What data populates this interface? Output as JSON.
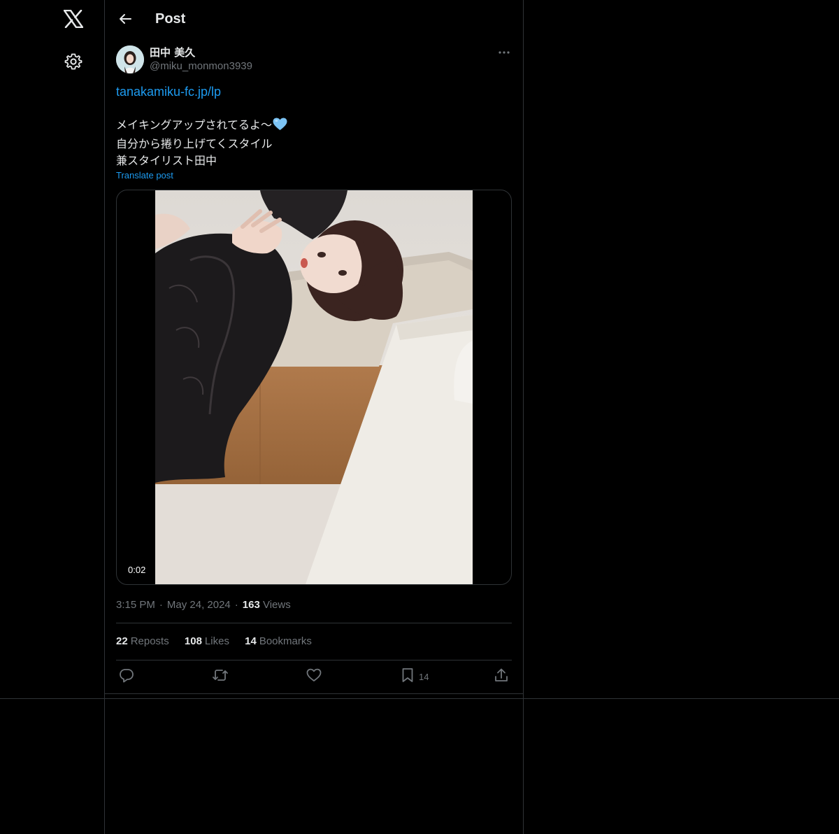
{
  "header": {
    "title": "Post"
  },
  "author": {
    "name": "田中 美久",
    "handle": "@miku_monmon3939"
  },
  "post": {
    "link": "tanakamiku-fc.jp/lp",
    "lines": [
      "メイキングアップされてるよ〜",
      "自分から捲り上げてくスタイル",
      "兼スタイリスト田中"
    ],
    "translate_label": "Translate post"
  },
  "media": {
    "duration": "0:02"
  },
  "meta": {
    "time": "3:15 PM",
    "date": "May 24, 2024",
    "views_count": "163",
    "views_label": "Views"
  },
  "stats": {
    "reposts_count": "22",
    "reposts_label": "Reposts",
    "likes_count": "108",
    "likes_label": "Likes",
    "bookmarks_count": "14",
    "bookmarks_label": "Bookmarks"
  },
  "actions": {
    "bookmark_count": "14"
  },
  "colors": {
    "accent": "#1d9bf0",
    "muted": "#71767b",
    "border": "#2f3336",
    "background": "#000000",
    "text": "#e7e9ea"
  },
  "icons": [
    "x-logo-icon",
    "gear-icon",
    "back-arrow-icon",
    "more-icon",
    "blue-heart-emoji-icon",
    "reply-icon",
    "repost-icon",
    "like-icon",
    "bookmark-icon",
    "share-icon"
  ]
}
